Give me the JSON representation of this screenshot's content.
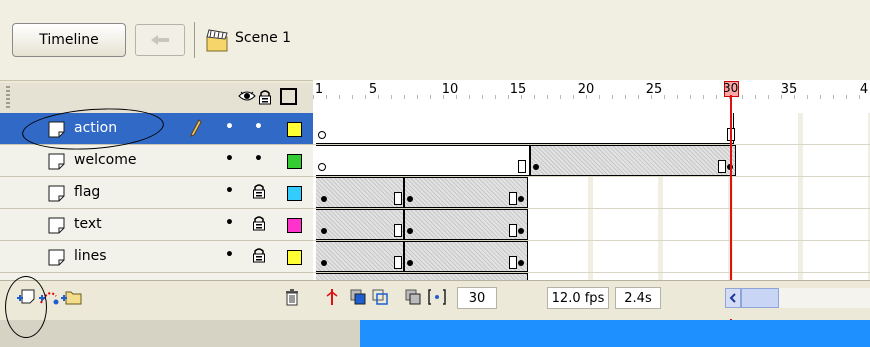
{
  "toolbar": {
    "timeline_label": "Timeline",
    "scene_label": "Scene 1"
  },
  "ruler": {
    "ticks": [
      "1",
      "5",
      "10",
      "15",
      "20",
      "25",
      "30",
      "35",
      "4"
    ],
    "current_frame": "30"
  },
  "layers": [
    {
      "name": "action",
      "selected": true,
      "editing": true,
      "visible": true,
      "locked": false,
      "color": "#ffff33"
    },
    {
      "name": "welcome",
      "selected": false,
      "editing": false,
      "visible": true,
      "locked": false,
      "color": "#33cc33"
    },
    {
      "name": "flag",
      "selected": false,
      "editing": false,
      "visible": true,
      "locked": true,
      "color": "#33ccff"
    },
    {
      "name": "text",
      "selected": false,
      "editing": false,
      "visible": true,
      "locked": true,
      "color": "#ff33cc"
    },
    {
      "name": "lines",
      "selected": false,
      "editing": false,
      "visible": true,
      "locked": true,
      "color": "#ffff33"
    }
  ],
  "status": {
    "frame": "30",
    "fps": "12.0 fps",
    "time": "2.4s"
  },
  "icons": {
    "eye": "eye-icon",
    "lock": "lock-icon",
    "outline": "outline-icon",
    "trash": "trash-icon",
    "back": "back-arrow-icon",
    "scene": "scene-clapper-icon"
  }
}
